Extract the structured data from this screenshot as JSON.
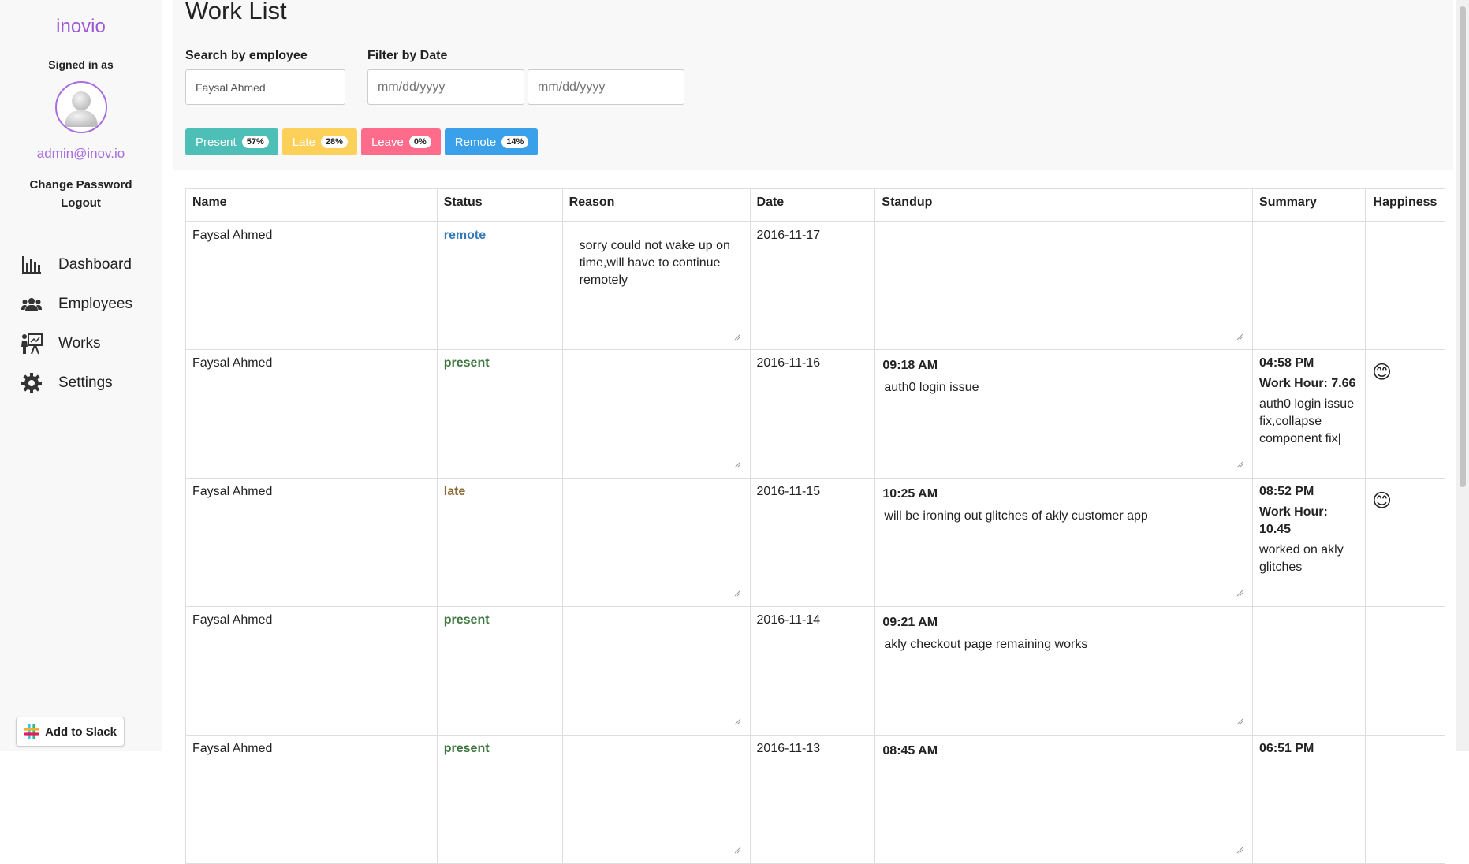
{
  "sidebar": {
    "brand": "inovio",
    "signed_in_label": "Signed in as",
    "email": "admin@inov.io",
    "change_password": "Change Password",
    "logout": "Logout",
    "nav": [
      {
        "label": "Dashboard",
        "icon": "bar-chart-icon"
      },
      {
        "label": "Employees",
        "icon": "users-icon"
      },
      {
        "label": "Works",
        "icon": "presentation-icon"
      },
      {
        "label": "Settings",
        "icon": "gear-icon"
      }
    ],
    "slack_button": "Add to Slack"
  },
  "page": {
    "title": "Work List",
    "search_label": "Search by employee",
    "search_value": "Faysal Ahmed",
    "filter_label": "Filter by Date",
    "date_from_placeholder": "mm/dd/yyyy",
    "date_to_placeholder": "mm/dd/yyyy"
  },
  "badges": [
    {
      "label": "Present",
      "value": "57%",
      "color": "#4dbfb7"
    },
    {
      "label": "Late",
      "value": "28%",
      "color": "#fdd05a"
    },
    {
      "label": "Leave",
      "value": "0%",
      "color": "#ff6b8b"
    },
    {
      "label": "Remote",
      "value": "14%",
      "color": "#3aa0ea"
    }
  ],
  "table": {
    "headers": [
      "Name",
      "Status",
      "Reason",
      "Date",
      "Standup",
      "Summary",
      "Happiness"
    ],
    "rows": [
      {
        "name": "Faysal Ahmed",
        "status": "remote",
        "status_color": "#337ab7",
        "reason": "sorry could not wake up on time,will have to continue remotely",
        "date": "2016-11-17",
        "standup_time": "",
        "standup": "",
        "summary_time": "",
        "work_hour": "",
        "summary": "",
        "happiness": ""
      },
      {
        "name": "Faysal Ahmed",
        "status": "present",
        "status_color": "#3c763d",
        "reason": "",
        "date": "2016-11-16",
        "standup_time": "09:18 AM",
        "standup": "auth0 login issue",
        "summary_time": "04:58 PM",
        "work_hour": "Work Hour: 7.66",
        "summary": "auth0 login issue fix,collapse component fix|",
        "happiness": "😊"
      },
      {
        "name": "Faysal Ahmed",
        "status": "late",
        "status_color": "#8a6d3b",
        "reason": "",
        "date": "2016-11-15",
        "standup_time": "10:25 AM",
        "standup": "will be ironing out glitches of akly customer app",
        "summary_time": "08:52 PM",
        "work_hour": "Work Hour: 10.45",
        "summary": "worked on akly glitches",
        "happiness": "😊"
      },
      {
        "name": "Faysal Ahmed",
        "status": "present",
        "status_color": "#3c763d",
        "reason": "",
        "date": "2016-11-14",
        "standup_time": "09:21 AM",
        "standup": "akly checkout page remaining works",
        "summary_time": "",
        "work_hour": "",
        "summary": "",
        "happiness": ""
      },
      {
        "name": "Faysal Ahmed",
        "status": "present",
        "status_color": "#3c763d",
        "reason": "",
        "date": "2016-11-13",
        "standup_time": "08:45 AM",
        "standup": "",
        "summary_time": "06:51 PM",
        "work_hour": "",
        "summary": "",
        "happiness": ""
      }
    ]
  }
}
